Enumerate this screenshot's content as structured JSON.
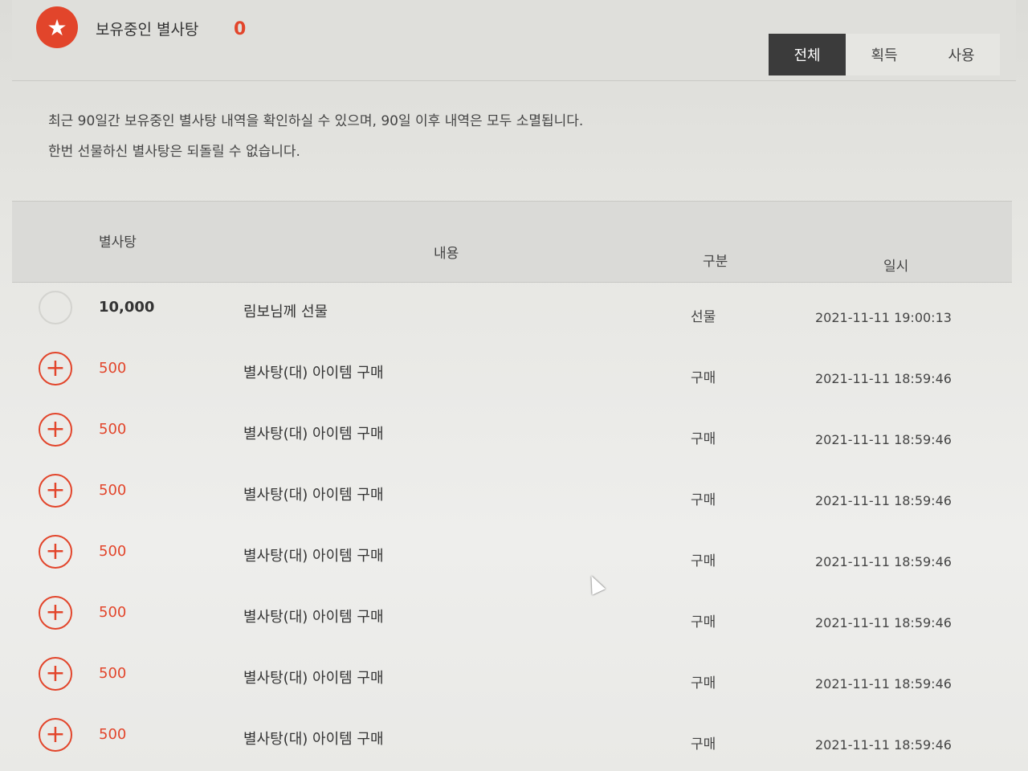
{
  "header": {
    "title": "보유중인 별사탕",
    "count": "0",
    "icon": "star-icon",
    "accent_color": "#e2452b"
  },
  "tabs": [
    {
      "label": "전체",
      "active": true
    },
    {
      "label": "획득",
      "active": false
    },
    {
      "label": "사용",
      "active": false
    }
  ],
  "notice": {
    "line1": "최근 90일간 보유중인 별사탕 내역을 확인하실 수 있으며, 90일 이후 내역은 모두 소멸됩니다.",
    "line2": "한번 선물하신 별사탕은 되돌릴 수 없습니다."
  },
  "table": {
    "headers": {
      "amount": "별사탕",
      "content": "내용",
      "category": "구분",
      "datetime": "일시"
    },
    "rows": [
      {
        "icon": "none",
        "amount": "10,000",
        "content": "림보님께 선물",
        "category": "선물",
        "datetime": "2021-11-11 19:00:13"
      },
      {
        "icon": "plus-icon",
        "amount": "500",
        "content": "별사탕(대) 아이템 구매",
        "category": "구매",
        "datetime": "2021-11-11 18:59:46"
      },
      {
        "icon": "plus-icon",
        "amount": "500",
        "content": "별사탕(대) 아이템 구매",
        "category": "구매",
        "datetime": "2021-11-11 18:59:46"
      },
      {
        "icon": "plus-icon",
        "amount": "500",
        "content": "별사탕(대) 아이템 구매",
        "category": "구매",
        "datetime": "2021-11-11 18:59:46"
      },
      {
        "icon": "plus-icon",
        "amount": "500",
        "content": "별사탕(대) 아이템 구매",
        "category": "구매",
        "datetime": "2021-11-11 18:59:46"
      },
      {
        "icon": "plus-icon",
        "amount": "500",
        "content": "별사탕(대) 아이템 구매",
        "category": "구매",
        "datetime": "2021-11-11 18:59:46"
      },
      {
        "icon": "plus-icon",
        "amount": "500",
        "content": "별사탕(대) 아이템 구매",
        "category": "구매",
        "datetime": "2021-11-11 18:59:46"
      },
      {
        "icon": "plus-icon",
        "amount": "500",
        "content": "별사탕(대) 아이템 구매",
        "category": "구매",
        "datetime": "2021-11-11 18:59:46"
      }
    ]
  }
}
